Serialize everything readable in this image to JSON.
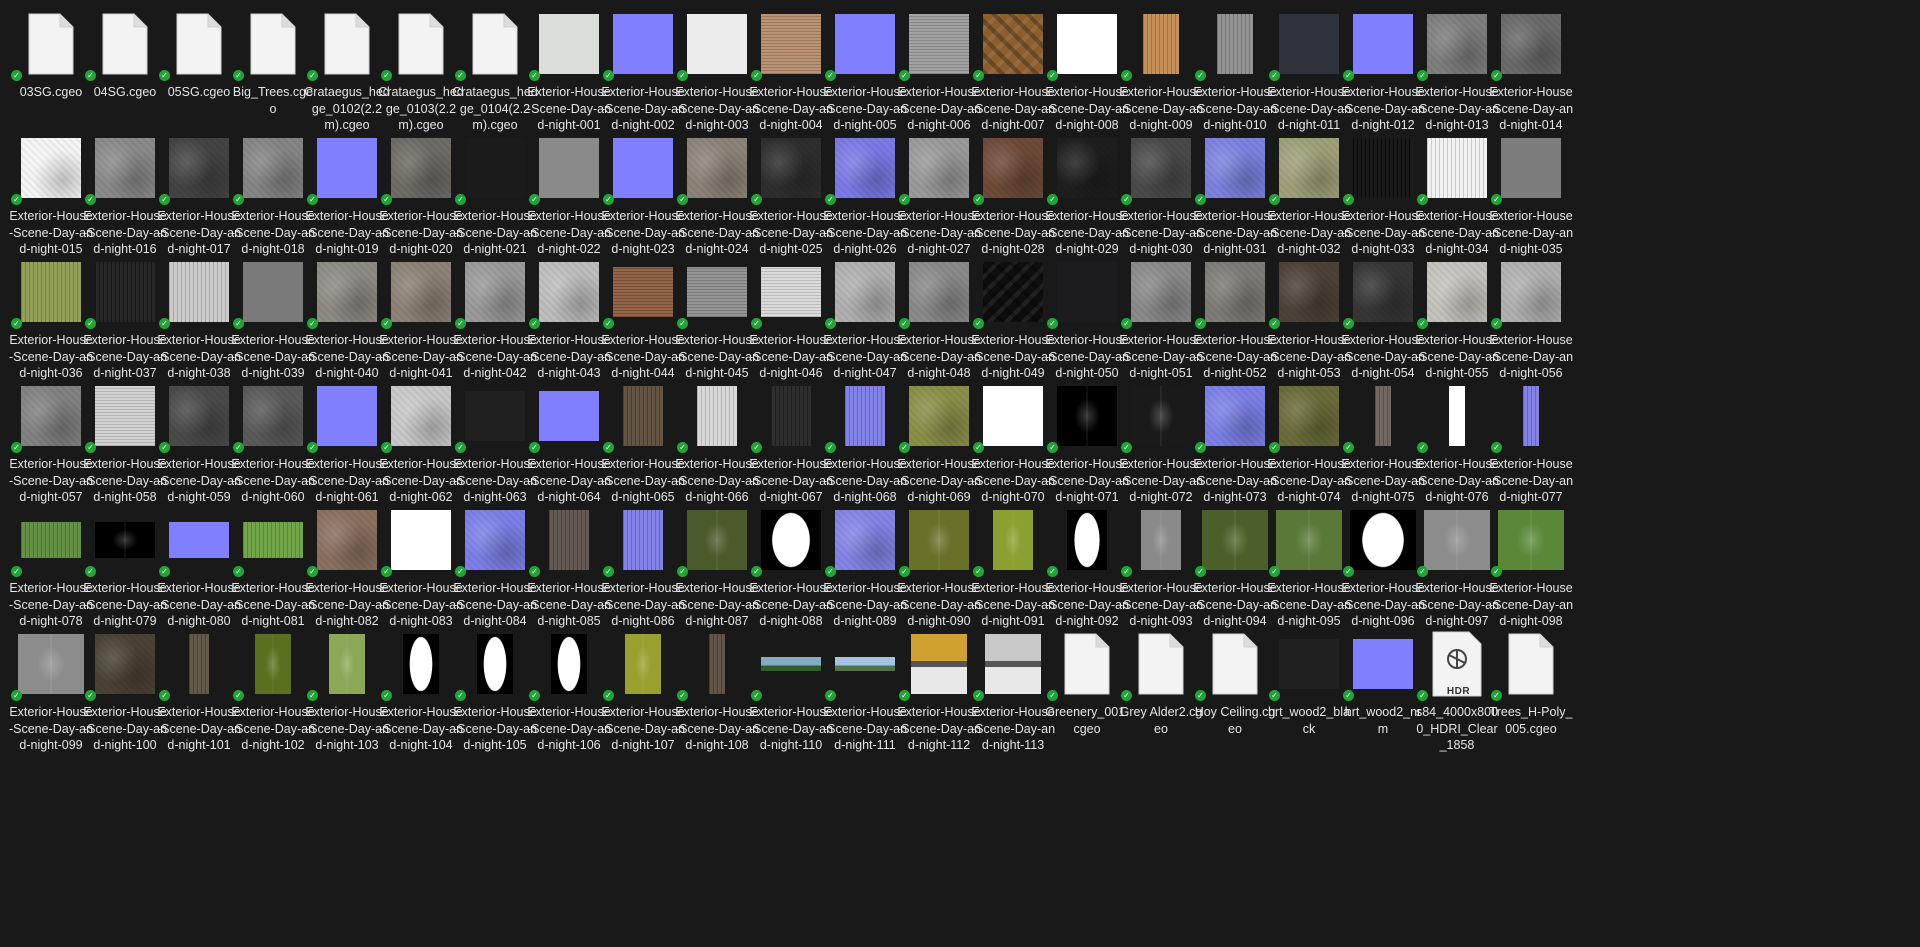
{
  "files": [
    {
      "name": "03SG.cgeo",
      "kind": "doc"
    },
    {
      "name": "04SG.cgeo",
      "kind": "doc"
    },
    {
      "name": "05SG.cgeo",
      "kind": "doc"
    },
    {
      "name": "Big_Trees.cgeo",
      "kind": "doc"
    },
    {
      "name": "Crataegus_hedge_0102(2.2m).cgeo",
      "kind": "doc"
    },
    {
      "name": "Crataegus_hedge_0103(2.2m).cgeo",
      "kind": "doc"
    },
    {
      "name": "Crataegus_hedge_0104(2.2m).cgeo",
      "kind": "doc"
    },
    {
      "name": "Exterior-House-Scene-Day-and-night-001",
      "kind": "tex",
      "c": "#dcdedb"
    },
    {
      "name": "Exterior-House-Scene-Day-and-night-002",
      "kind": "tex",
      "c": "#8080ff"
    },
    {
      "name": "Exterior-House-Scene-Day-and-night-003",
      "kind": "tex",
      "c": "#ececec"
    },
    {
      "name": "Exterior-House-Scene-Day-and-night-004",
      "kind": "tex",
      "c": "#b58c6a",
      "p": "hl"
    },
    {
      "name": "Exterior-House-Scene-Day-and-night-005",
      "kind": "tex",
      "c": "#8080ff"
    },
    {
      "name": "Exterior-House-Scene-Day-and-night-006",
      "kind": "tex",
      "c": "#9c9c9c",
      "p": "hl"
    },
    {
      "name": "Exterior-House-Scene-Day-and-night-007",
      "kind": "tex",
      "c": "#8b5e2e",
      "p": "dg"
    },
    {
      "name": "Exterior-House-Scene-Day-and-night-008",
      "kind": "tex",
      "c": "#ffffff"
    },
    {
      "name": "Exterior-House-Scene-Day-and-night-009",
      "kind": "tex",
      "c": "#c0894e",
      "w": 36,
      "p": "vl"
    },
    {
      "name": "Exterior-House-Scene-Day-and-night-010",
      "kind": "tex",
      "c": "#8c8c8c",
      "w": 36,
      "p": "vl"
    },
    {
      "name": "Exterior-House-Scene-Day-and-night-011",
      "kind": "tex",
      "c": "#2d323b"
    },
    {
      "name": "Exterior-House-Scene-Day-and-night-012",
      "kind": "tex",
      "c": "#8080ff"
    },
    {
      "name": "Exterior-House-Scene-Day-and-night-013",
      "kind": "tex",
      "c": "#7e7e7e",
      "p": "nz"
    },
    {
      "name": "Exterior-House-Scene-Day-and-night-014",
      "kind": "tex",
      "c": "#6a6a6a",
      "p": "nz"
    },
    {
      "name": "Exterior-House-Scene-Day-and-night-015",
      "kind": "tex",
      "c": "#f4f4f4",
      "p": "nz"
    },
    {
      "name": "Exterior-House-Scene-Day-and-night-016",
      "kind": "tex",
      "c": "#8a8a8a",
      "p": "nz"
    },
    {
      "name": "Exterior-House-Scene-Day-and-night-017",
      "kind": "tex",
      "c": "#444444",
      "p": "nz"
    },
    {
      "name": "Exterior-House-Scene-Day-and-night-018",
      "kind": "tex",
      "c": "#858585",
      "p": "nz"
    },
    {
      "name": "Exterior-House-Scene-Day-and-night-019",
      "kind": "tex",
      "c": "#8080ff"
    },
    {
      "name": "Exterior-House-Scene-Day-and-night-020",
      "kind": "tex",
      "c": "#6f6b66",
      "p": "nz"
    },
    {
      "name": "Exterior-House-Scene-Day-and-night-021",
      "kind": "tex",
      "c": "#1b1b1b"
    },
    {
      "name": "Exterior-House-Scene-Day-and-night-022",
      "kind": "tex",
      "c": "#8a8a8a"
    },
    {
      "name": "Exterior-House-Scene-Day-and-night-023",
      "kind": "tex",
      "c": "#8080ff"
    },
    {
      "name": "Exterior-House-Scene-Day-and-night-024",
      "kind": "tex",
      "c": "#8a8478",
      "p": "nz"
    },
    {
      "name": "Exterior-House-Scene-Day-and-night-025",
      "kind": "tex",
      "c": "#2e2e2e",
      "p": "nz"
    },
    {
      "name": "Exterior-House-Scene-Day-and-night-026",
      "kind": "tex",
      "c": "#7a7ae6",
      "p": "nz"
    },
    {
      "name": "Exterior-House-Scene-Day-and-night-027",
      "kind": "tex",
      "c": "#9a9a9a",
      "p": "nz"
    },
    {
      "name": "Exterior-House-Scene-Day-and-night-028",
      "kind": "tex",
      "c": "#6e4a38",
      "p": "nz"
    },
    {
      "name": "Exterior-House-Scene-Day-and-night-029",
      "kind": "tex",
      "c": "#1e1e1e",
      "p": "nz"
    },
    {
      "name": "Exterior-House-Scene-Day-and-night-030",
      "kind": "tex",
      "c": "#4a4a4a",
      "p": "nz"
    },
    {
      "name": "Exterior-House-Scene-Day-and-night-031",
      "kind": "tex",
      "c": "#7c82e0",
      "p": "nz"
    },
    {
      "name": "Exterior-House-Scene-Day-and-night-032",
      "kind": "tex",
      "c": "#9fa07a",
      "p": "nz"
    },
    {
      "name": "Exterior-House-Scene-Day-and-night-033",
      "kind": "tex",
      "c": "#0c0c0c",
      "p": "vl"
    },
    {
      "name": "Exterior-House-Scene-Day-and-night-034",
      "kind": "tex",
      "c": "#f0f0f0",
      "p": "vl"
    },
    {
      "name": "Exterior-House-Scene-Day-and-night-035",
      "kind": "tex",
      "c": "#7c7c7c"
    },
    {
      "name": "Exterior-House-Scene-Day-and-night-036",
      "kind": "tex",
      "c": "#8c9a4e",
      "p": "vl"
    },
    {
      "name": "Exterior-House-Scene-Day-and-night-037",
      "kind": "tex",
      "c": "#1a1a1a",
      "p": "vl"
    },
    {
      "name": "Exterior-House-Scene-Day-and-night-038",
      "kind": "tex",
      "c": "#c8c8c8",
      "p": "vl"
    },
    {
      "name": "Exterior-House-Scene-Day-and-night-039",
      "kind": "tex",
      "c": "#7a7a7a"
    },
    {
      "name": "Exterior-House-Scene-Day-and-night-040",
      "kind": "tex",
      "c": "#8e8a84",
      "p": "nz"
    },
    {
      "name": "Exterior-House-Scene-Day-and-night-041",
      "kind": "tex",
      "c": "#8c8275",
      "p": "nz"
    },
    {
      "name": "Exterior-House-Scene-Day-and-night-042",
      "kind": "tex",
      "c": "#9a9a9a",
      "p": "nz"
    },
    {
      "name": "Exterior-House-Scene-Day-and-night-043",
      "kind": "tex",
      "c": "#bdbdbd",
      "p": "nz"
    },
    {
      "name": "Exterior-House-Scene-Day-and-night-044",
      "kind": "tex",
      "c": "#8a5a3c",
      "h": 50,
      "p": "hl"
    },
    {
      "name": "Exterior-House-Scene-Day-and-night-045",
      "kind": "tex",
      "c": "#8e8e8e",
      "h": 50,
      "p": "hl"
    },
    {
      "name": "Exterior-House-Scene-Day-and-night-046",
      "kind": "tex",
      "c": "#d8d8d8",
      "h": 50,
      "p": "hl"
    },
    {
      "name": "Exterior-House-Scene-Day-and-night-047",
      "kind": "tex",
      "c": "#b0b0b0",
      "p": "nz"
    },
    {
      "name": "Exterior-House-Scene-Day-and-night-048",
      "kind": "tex",
      "c": "#8a8a8a",
      "p": "nz"
    },
    {
      "name": "Exterior-House-Scene-Day-and-night-049",
      "kind": "tex",
      "c": "#0e0e0e",
      "p": "dg"
    },
    {
      "name": "Exterior-House-Scene-Day-and-night-050",
      "kind": "tex",
      "c": "#1c1c1e"
    },
    {
      "name": "Exterior-House-Scene-Day-and-night-051",
      "kind": "tex",
      "c": "#8a8a8a",
      "p": "nz"
    },
    {
      "name": "Exterior-House-Scene-Day-and-night-052",
      "kind": "tex",
      "c": "#7e7c76",
      "p": "nz"
    },
    {
      "name": "Exterior-House-Scene-Day-and-night-053",
      "kind": "tex",
      "c": "#4e4238",
      "p": "nz"
    },
    {
      "name": "Exterior-House-Scene-Day-and-night-054",
      "kind": "tex",
      "c": "#363636",
      "p": "nz"
    },
    {
      "name": "Exterior-House-Scene-Day-and-night-055",
      "kind": "tex",
      "c": "#c4c2bc",
      "p": "nz"
    },
    {
      "name": "Exterior-House-Scene-Day-and-night-056",
      "kind": "tex",
      "c": "#b0b0b0",
      "p": "nz"
    },
    {
      "name": "Exterior-House-Scene-Day-and-night-057",
      "kind": "tex",
      "c": "#828282",
      "p": "nz"
    },
    {
      "name": "Exterior-House-Scene-Day-and-night-058",
      "kind": "tex",
      "c": "#d0d0d0",
      "p": "hl"
    },
    {
      "name": "Exterior-House-Scene-Day-and-night-059",
      "kind": "tex",
      "c": "#4a4a4a",
      "p": "nz"
    },
    {
      "name": "Exterior-House-Scene-Day-and-night-060",
      "kind": "tex",
      "c": "#5a5a5a",
      "p": "nz"
    },
    {
      "name": "Exterior-House-Scene-Day-and-night-061",
      "kind": "tex",
      "c": "#8080ff"
    },
    {
      "name": "Exterior-House-Scene-Day-and-night-062",
      "kind": "tex",
      "c": "#c8c8c8",
      "p": "nz"
    },
    {
      "name": "Exterior-House-Scene-Day-and-night-063",
      "kind": "tex",
      "c": "#202020",
      "h": 50
    },
    {
      "name": "Exterior-House-Scene-Day-and-night-064",
      "kind": "tex",
      "c": "#8080ff",
      "h": 50
    },
    {
      "name": "Exterior-House-Scene-Day-and-night-065",
      "kind": "tex",
      "c": "#5a4a38",
      "w": 40,
      "p": "vl"
    },
    {
      "name": "Exterior-House-Scene-Day-and-night-066",
      "kind": "tex",
      "c": "#d6d6d6",
      "w": 40,
      "p": "vl"
    },
    {
      "name": "Exterior-House-Scene-Day-and-night-067",
      "kind": "tex",
      "c": "#222222",
      "w": 40,
      "p": "vl"
    },
    {
      "name": "Exterior-House-Scene-Day-and-night-068",
      "kind": "tex",
      "c": "#7a7ae6",
      "w": 40,
      "p": "vl"
    },
    {
      "name": "Exterior-House-Scene-Day-and-night-069",
      "kind": "tex",
      "c": "#8a8f48",
      "p": "nz"
    },
    {
      "name": "Exterior-House-Scene-Day-and-night-070",
      "kind": "tex",
      "c": "#ffffff"
    },
    {
      "name": "Exterior-House-Scene-Day-and-night-071",
      "kind": "tex",
      "c": "#000000",
      "p": "lf"
    },
    {
      "name": "Exterior-House-Scene-Day-and-night-072",
      "kind": "tex",
      "c": "#1a1a1a",
      "p": "lf"
    },
    {
      "name": "Exterior-House-Scene-Day-and-night-073",
      "kind": "tex",
      "c": "#7c80e6",
      "p": "nz"
    },
    {
      "name": "Exterior-House-Scene-Day-and-night-074",
      "kind": "tex",
      "c": "#6a6c3a",
      "p": "nz"
    },
    {
      "name": "Exterior-House-Scene-Day-and-night-075",
      "kind": "tex",
      "c": "#6a6058",
      "w": 16,
      "p": "vl"
    },
    {
      "name": "Exterior-House-Scene-Day-and-night-076",
      "kind": "tex",
      "c": "#ffffff",
      "w": 16
    },
    {
      "name": "Exterior-House-Scene-Day-and-night-077",
      "kind": "tex",
      "c": "#7a7ae6",
      "w": 16,
      "p": "vl"
    },
    {
      "name": "Exterior-House-Scene-Day-and-night-078",
      "kind": "tex",
      "c": "#5a8a3a",
      "h": 36,
      "p": "vl"
    },
    {
      "name": "Exterior-House-Scene-Day-and-night-079",
      "kind": "tex",
      "c": "#000000",
      "h": 36,
      "p": "lf"
    },
    {
      "name": "Exterior-House-Scene-Day-and-night-080",
      "kind": "tex",
      "c": "#8080ff",
      "h": 36
    },
    {
      "name": "Exterior-House-Scene-Day-and-night-081",
      "kind": "tex",
      "c": "#6aa040",
      "h": 36,
      "p": "vl"
    },
    {
      "name": "Exterior-House-Scene-Day-and-night-082",
      "kind": "tex",
      "c": "#8a7060",
      "p": "nz"
    },
    {
      "name": "Exterior-House-Scene-Day-and-night-083",
      "kind": "tex",
      "c": "#ffffff"
    },
    {
      "name": "Exterior-House-Scene-Day-and-night-084",
      "kind": "tex",
      "c": "#7c80e6",
      "p": "nz"
    },
    {
      "name": "Exterior-House-Scene-Day-and-night-085",
      "kind": "tex",
      "c": "#5a5048",
      "w": 40,
      "p": "vl"
    },
    {
      "name": "Exterior-House-Scene-Day-and-night-086",
      "kind": "tex",
      "c": "#7a7ae6",
      "w": 40,
      "p": "vl"
    },
    {
      "name": "Exterior-House-Scene-Day-and-night-087",
      "kind": "tex",
      "c": "#4a5a2a",
      "p": "lf"
    },
    {
      "name": "Exterior-House-Scene-Day-and-night-088",
      "kind": "tex",
      "c": "#000000",
      "p": "lw"
    },
    {
      "name": "Exterior-House-Scene-Day-and-night-089",
      "kind": "tex",
      "c": "#8484e6",
      "p": "nz"
    },
    {
      "name": "Exterior-House-Scene-Day-and-night-090",
      "kind": "tex",
      "c": "#6a7028",
      "p": "lf"
    },
    {
      "name": "Exterior-House-Scene-Day-and-night-091",
      "kind": "tex",
      "c": "#8aa030",
      "w": 40,
      "p": "lf"
    },
    {
      "name": "Exterior-House-Scene-Day-and-night-092",
      "kind": "tex",
      "c": "#000000",
      "w": 40,
      "p": "lw"
    },
    {
      "name": "Exterior-House-Scene-Day-and-night-093",
      "kind": "tex",
      "c": "#8a8a8a",
      "w": 40,
      "p": "lf"
    },
    {
      "name": "Exterior-House-Scene-Day-and-night-094",
      "kind": "tex",
      "c": "#4a6028",
      "w": 66,
      "p": "lf"
    },
    {
      "name": "Exterior-House-Scene-Day-and-night-095",
      "kind": "tex",
      "c": "#5a7838",
      "w": 66,
      "p": "lf"
    },
    {
      "name": "Exterior-House-Scene-Day-and-night-096",
      "kind": "tex",
      "c": "#000000",
      "w": 66,
      "p": "lw"
    },
    {
      "name": "Exterior-House-Scene-Day-and-night-097",
      "kind": "tex",
      "c": "#8c8c8c",
      "w": 66,
      "p": "lf"
    },
    {
      "name": "Exterior-House-Scene-Day-and-night-098",
      "kind": "tex",
      "c": "#5a8838",
      "w": 66,
      "p": "lf"
    },
    {
      "name": "Exterior-House-Scene-Day-and-night-099",
      "kind": "tex",
      "c": "#8c8c8c",
      "w": 66,
      "p": "lf"
    },
    {
      "name": "Exterior-House-Scene-Day-and-night-100",
      "kind": "tex",
      "c": "#4a4234",
      "p": "nz"
    },
    {
      "name": "Exterior-House-Scene-Day-and-night-101",
      "kind": "tex",
      "c": "#5a5040",
      "w": 20,
      "p": "vl"
    },
    {
      "name": "Exterior-House-Scene-Day-and-night-102",
      "kind": "tex",
      "c": "#5a7020",
      "w": 36,
      "p": "lf"
    },
    {
      "name": "Exterior-House-Scene-Day-and-night-103",
      "kind": "tex",
      "c": "#8aa858",
      "w": 36,
      "p": "lf"
    },
    {
      "name": "Exterior-House-Scene-Day-and-night-104",
      "kind": "tex",
      "c": "#000000",
      "w": 36,
      "p": "lw"
    },
    {
      "name": "Exterior-House-Scene-Day-and-night-105",
      "kind": "tex",
      "c": "#000000",
      "w": 36,
      "p": "lw"
    },
    {
      "name": "Exterior-House-Scene-Day-and-night-106",
      "kind": "tex",
      "c": "#000000",
      "w": 36,
      "p": "lw"
    },
    {
      "name": "Exterior-House-Scene-Day-and-night-107",
      "kind": "tex",
      "c": "#9aa030",
      "w": 36,
      "p": "lf"
    },
    {
      "name": "Exterior-House-Scene-Day-and-night-108",
      "kind": "tex",
      "c": "#5a4a3c",
      "w": 16,
      "p": "vl"
    },
    {
      "name": "Exterior-House-Scene-Day-and-night-110",
      "kind": "tex",
      "c": "#5a8a5a",
      "h": 14,
      "p": "pano"
    },
    {
      "name": "Exterior-House-Scene-Day-and-night-111",
      "kind": "tex",
      "c": "#ffffff",
      "h": 14,
      "p": "pano"
    },
    {
      "name": "Exterior-House-Scene-Day-and-night-112",
      "kind": "tex",
      "c": "#d0a030",
      "w": 56,
      "p": "split"
    },
    {
      "name": "Exterior-House-Scene-Day-and-night-113",
      "kind": "tex",
      "c": "#c8c8c8",
      "w": 56,
      "p": "split"
    },
    {
      "name": "Greenery_001.cgeo",
      "kind": "doc"
    },
    {
      "name": "Grey Alder2.cgeo",
      "kind": "doc"
    },
    {
      "name": "Hoy Ceiling.cgeo",
      "kind": "doc"
    },
    {
      "name": "hrt_wood2_black",
      "kind": "tex",
      "c": "#202020",
      "h": 50
    },
    {
      "name": "hrt_wood2_nrm",
      "kind": "tex",
      "c": "#8080ff",
      "h": 50
    },
    {
      "name": "s84_4000x8000_HDRI_Clear_1858",
      "kind": "hdr",
      "hdr_label": "HDR"
    },
    {
      "name": "Trees_H-Poly_005.cgeo",
      "kind": "doc"
    }
  ]
}
